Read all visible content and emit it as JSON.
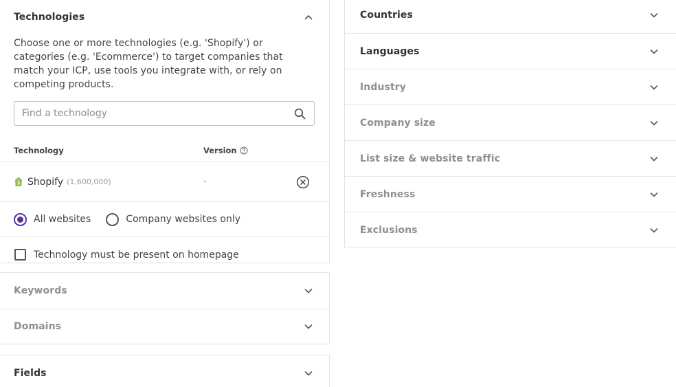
{
  "technologies": {
    "title": "Technologies",
    "description": "Choose one or more technologies (e.g. 'Shopify') or categories (e.g. 'Ecommerce') to target companies that match your ICP, use tools you integrate with, or rely on competing products.",
    "search_placeholder": "Find a technology",
    "col_technology": "Technology",
    "col_version": "Version",
    "rows": [
      {
        "name": "Shopify",
        "count": "(1,600,000)",
        "version": "-"
      }
    ],
    "radio_all": "All websites",
    "radio_company": "Company websites only",
    "radio_selected": "All websites",
    "homepage_checkbox": "Technology must be present on homepage",
    "homepage_checked": false
  },
  "left_sections": {
    "keywords": "Keywords",
    "domains": "Domains",
    "fields": "Fields"
  },
  "right_sections": {
    "countries": "Countries",
    "languages": "Languages",
    "industry": "Industry",
    "company_size": "Company size",
    "list_size": "List size & website traffic",
    "freshness": "Freshness",
    "exclusions": "Exclusions"
  },
  "colors": {
    "accent": "#5a2ea6",
    "shopify": "#95bf47"
  }
}
